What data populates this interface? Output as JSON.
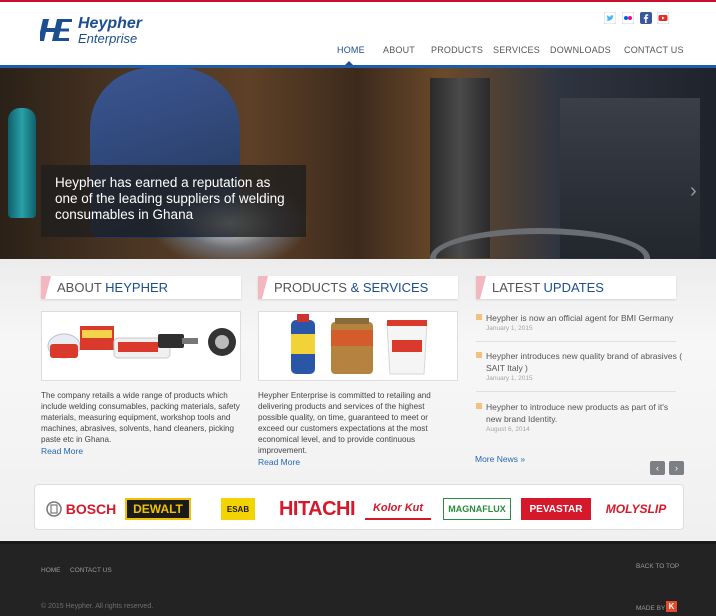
{
  "brand": {
    "name": "Heypher",
    "sub": "Enterprise"
  },
  "social": [
    {
      "icon": "twitter-icon",
      "color": "#4ab3f4"
    },
    {
      "icon": "flickr-icon",
      "color": "#ff0084"
    },
    {
      "icon": "facebook-icon",
      "color": "#3b5998"
    },
    {
      "icon": "youtube-icon",
      "color": "#e52d27"
    }
  ],
  "nav": [
    "HOME",
    "ABOUT",
    "PRODUCTS",
    "SERVICES",
    "DOWNLOADS",
    "CONTACT US"
  ],
  "hero": {
    "caption": "Heypher has earned a reputation as one of the leading suppliers of welding consumables in Ghana",
    "next_arrow": "›"
  },
  "about": {
    "title_plain": "ABOUT ",
    "title_accent": "HEYPHER",
    "text": "The company retails a wide range of products which include welding consumables, packing materials, safety materials, measuring equipment, workshop tools and machines, abrasives, solvents, hand cleaners, picking paste etc in Ghana.",
    "read_more": "Read More"
  },
  "products": {
    "title_plain": "PRODUCTS ",
    "title_accent": "& SERVICES",
    "text": "Heypher Enterprise is committed to retailing and delivering products and services of the highest possible quality, on time, guaranteed to meet or exceed our customers expectations at the most economical level, and to provide continuous improvement.",
    "read_more": "Read More"
  },
  "updates": {
    "title_plain": "LATEST ",
    "title_accent": "UPDATES",
    "items": [
      {
        "title": "Heypher is now an official agent for BMI Germany",
        "date": "January 1, 2015"
      },
      {
        "title": "Heypher introduces new quality brand of abrasives ( SAIT Italy )",
        "date": "January 1, 2015"
      },
      {
        "title": "Heypher to introduce new products as part of it's new brand Identity.",
        "date": "August 6, 2014"
      }
    ],
    "more": "More News »",
    "prev": "‹",
    "next": "›"
  },
  "brands": [
    "BOSCH",
    "DEWALT",
    "ESAB",
    "HITACHI",
    "Kolor Kut",
    "MAGNAFLUX",
    "PEVASTAR",
    "MOLYSLIP"
  ],
  "footer": {
    "links": [
      "HOME",
      "CONTACT US"
    ],
    "back_to_top": "BACK TO TOP",
    "copyright": "© 2015 Heypher. All rights reserved.",
    "made_by": "MADE BY",
    "made_by_logo": "K"
  }
}
